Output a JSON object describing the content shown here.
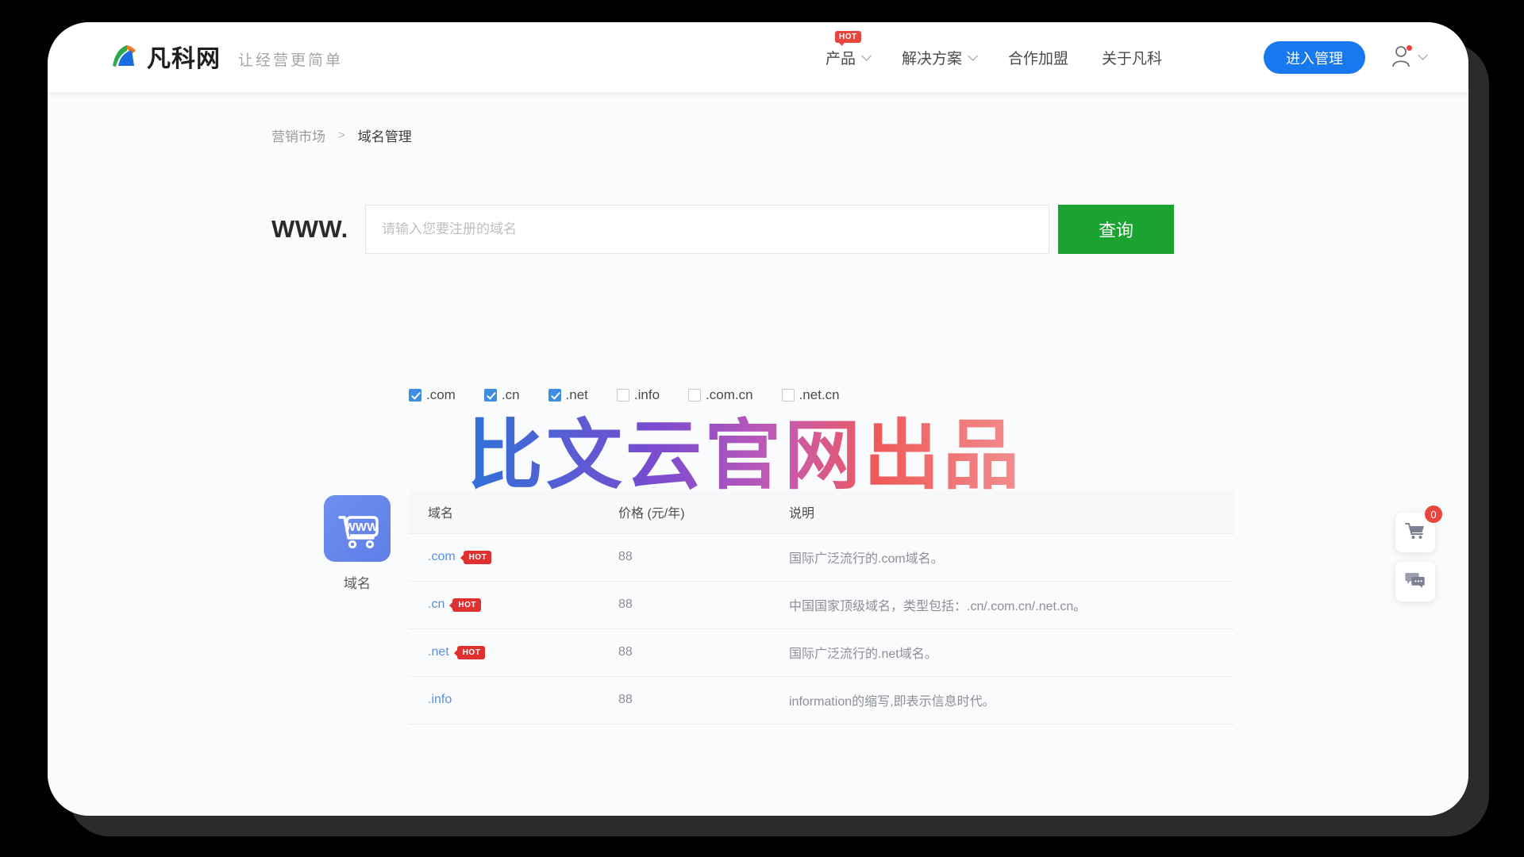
{
  "header": {
    "brand_name": "凡科网",
    "brand_tagline": "让经营更简单",
    "nav": [
      {
        "label": "产品",
        "badge": "HOT",
        "has_caret": true
      },
      {
        "label": "解决方案",
        "badge": "",
        "has_caret": true
      },
      {
        "label": "合作加盟",
        "badge": "",
        "has_caret": false
      },
      {
        "label": "关于凡科",
        "badge": "",
        "has_caret": false
      }
    ],
    "manage_button": "进入管理"
  },
  "breadcrumb": {
    "root": "营销市场",
    "separator": ">",
    "current": "域名管理"
  },
  "search": {
    "prefix_label": "WWW.",
    "placeholder": "请输入您要注册的域名",
    "value": "",
    "query_button": "查询"
  },
  "suffixes": [
    {
      "label": ".com",
      "checked": true
    },
    {
      "label": ".cn",
      "checked": true
    },
    {
      "label": ".net",
      "checked": true
    },
    {
      "label": ".info",
      "checked": false
    },
    {
      "label": ".com.cn",
      "checked": false
    },
    {
      "label": ".net.cn",
      "checked": false
    }
  ],
  "watermark": {
    "text": "比文云官网出品"
  },
  "product_card": {
    "label": "域名",
    "tile_text": "WWW"
  },
  "table": {
    "columns": [
      "域名",
      "价格 (元/年)",
      "说明"
    ],
    "rows": [
      {
        "domain": ".com",
        "badge": "HOT",
        "price": "88",
        "desc": "国际广泛流行的.com域名。"
      },
      {
        "domain": ".cn",
        "badge": "HOT",
        "price": "88",
        "desc": "中国国家顶级域名，类型包括：.cn/.com.cn/.net.cn。"
      },
      {
        "domain": ".net",
        "badge": "HOT",
        "price": "88",
        "desc": "国际广泛流行的.net域名。"
      },
      {
        "domain": ".info",
        "badge": "",
        "price": "88",
        "desc": "information的缩写,即表示信息时代。"
      }
    ]
  },
  "float_dock": {
    "cart_count": "0"
  },
  "colors": {
    "brand_blue": "#1878f0",
    "query_green": "#1aa331",
    "hot_red": "#e8453c",
    "checkbox_blue": "#3d8ee0",
    "link_blue": "#5a8fd6"
  }
}
